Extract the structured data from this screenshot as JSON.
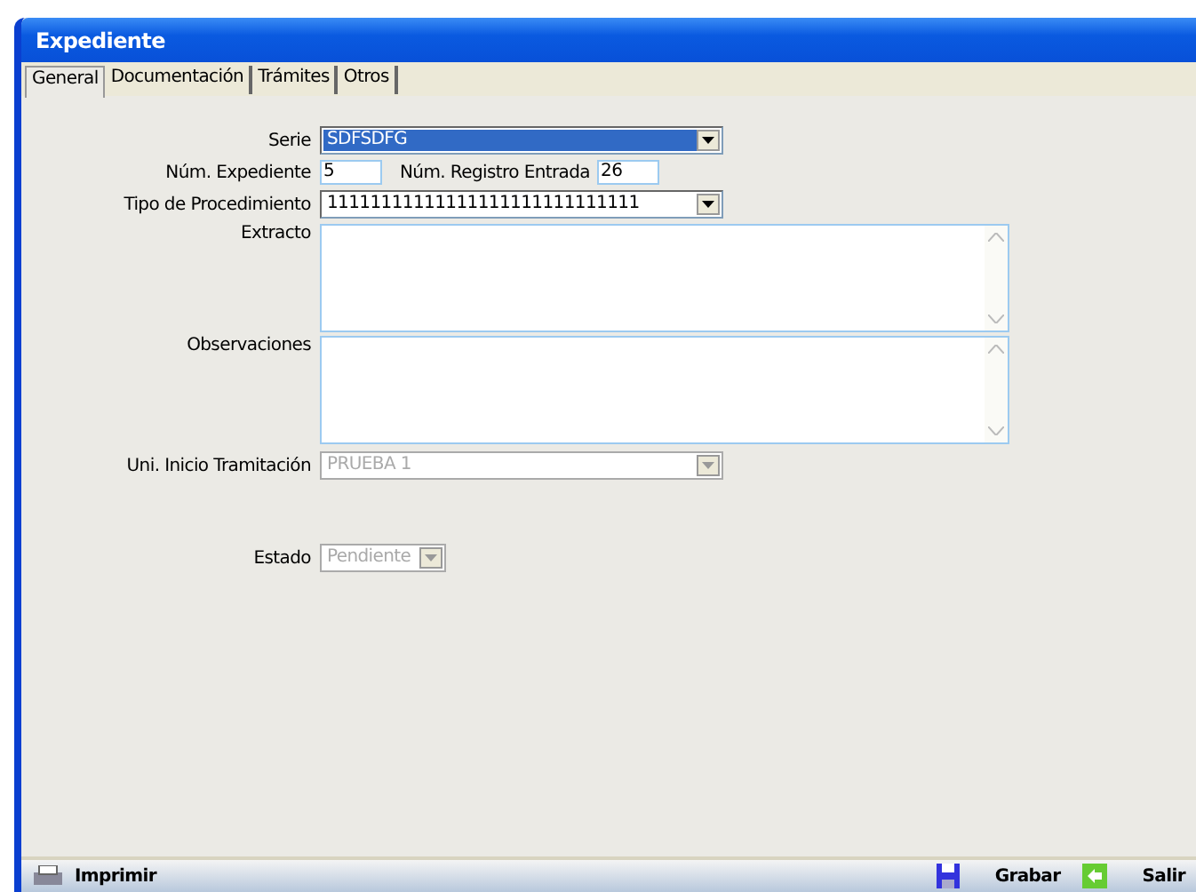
{
  "window": {
    "title": "Expediente"
  },
  "tabs": [
    {
      "label": "General",
      "selected": true
    },
    {
      "label": "Documentación",
      "selected": false
    },
    {
      "label": "Trámites",
      "selected": false
    },
    {
      "label": "Otros",
      "selected": false
    }
  ],
  "form": {
    "serie": {
      "label": "Serie",
      "value": "SDFSDFG",
      "highlighted": true
    },
    "num_expediente": {
      "label": "Núm. Expediente",
      "value": "5"
    },
    "num_registro": {
      "label": "Núm. Registro Entrada",
      "value": "26"
    },
    "tipo": {
      "label": "Tipo de Procedimiento",
      "value": "11111111111111111111111111111"
    },
    "extracto": {
      "label": "Extracto"
    },
    "observaciones": {
      "label": "Observaciones"
    },
    "unidad": {
      "label": "Uni. Inicio Tramitación",
      "value": "PRUEBA 1",
      "disabled": true
    },
    "estado": {
      "label": "Estado",
      "value": "Pendiente",
      "disabled": true
    }
  },
  "toolbar": [
    {
      "kind": "print",
      "label": "Imprimir"
    },
    {
      "kind": "save",
      "label": "Grabar"
    },
    {
      "kind": "exit",
      "label": "Salir"
    }
  ]
}
